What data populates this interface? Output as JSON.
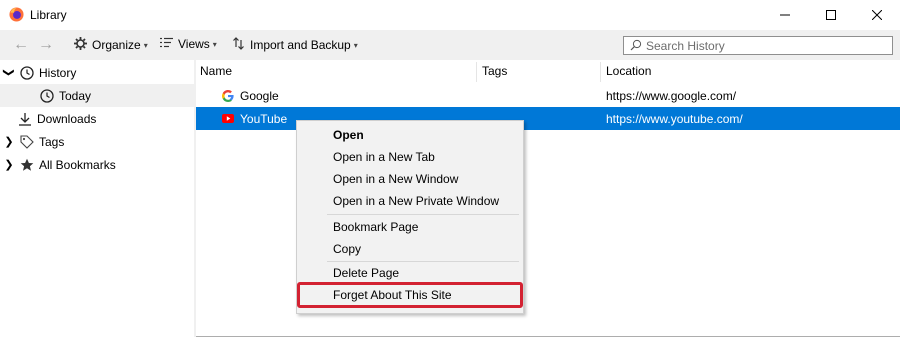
{
  "window": {
    "title": "Library",
    "buttons": {
      "minimize": "—",
      "maximize": "☐",
      "close": "✕"
    }
  },
  "toolbar": {
    "organize": "Organize",
    "views": "Views",
    "import_backup": "Import and Backup",
    "search_placeholder": "Search History"
  },
  "sidebar": {
    "items": [
      {
        "label": "History",
        "twisty": "❯",
        "icon": "clock-icon"
      },
      {
        "label": "Today",
        "icon": "clock-icon"
      },
      {
        "label": "Downloads",
        "icon": "download-icon"
      },
      {
        "label": "Tags",
        "twisty": "❯",
        "icon": "tag-icon"
      },
      {
        "label": "All Bookmarks",
        "twisty": "❯",
        "icon": "star-icon"
      }
    ]
  },
  "table": {
    "columns": {
      "name": "Name",
      "tags": "Tags",
      "location": "Location"
    },
    "rows": [
      {
        "name": "Google",
        "tags": "",
        "location": "https://www.google.com/",
        "icon": "google-icon"
      },
      {
        "name": "YouTube",
        "tags": "",
        "location": "https://www.youtube.com/",
        "icon": "youtube-icon"
      }
    ]
  },
  "context_menu": {
    "items": [
      {
        "label": "Open"
      },
      {
        "label": "Open in a New Tab"
      },
      {
        "label": "Open in a New Window"
      },
      {
        "label": "Open in a New Private Window"
      },
      {
        "label": "Bookmark Page"
      },
      {
        "label": "Copy"
      },
      {
        "label": "Delete Page"
      },
      {
        "label": "Forget About This Site"
      }
    ]
  },
  "colors": {
    "selection": "#0078d7",
    "highlight_border": "#d32232",
    "pane_bg": "#f0f0f0"
  }
}
